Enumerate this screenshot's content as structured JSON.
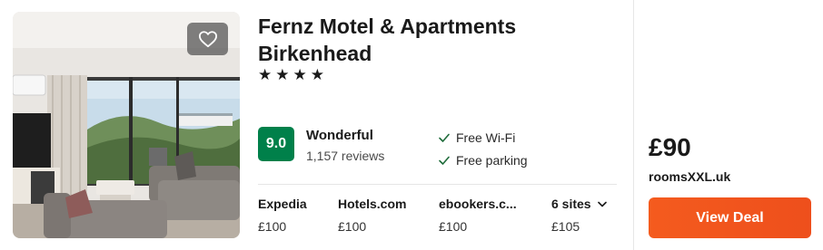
{
  "hotel": {
    "name": "Fernz Motel & Apartments Birkenhead",
    "stars": [
      "★",
      "★",
      "★",
      "★"
    ],
    "photo_alt": "hotel-room-photo"
  },
  "rating": {
    "score": "9.0",
    "label": "Wonderful",
    "reviews": "1,157 reviews",
    "color": "#00804a"
  },
  "amenities": [
    "Free Wi-Fi",
    "Free parking"
  ],
  "sites": [
    {
      "name": "Expedia",
      "price": "£100"
    },
    {
      "name": "Hotels.com",
      "price": "£100"
    },
    {
      "name": "ebookers.c...",
      "price": "£100"
    },
    {
      "name": "6 sites",
      "price": "£105"
    }
  ],
  "deal": {
    "price": "£90",
    "provider": "roomsXXL.uk",
    "button_label": "View Deal",
    "button_color": "#f15a1f"
  },
  "icons": {
    "favorite": "heart-outline-icon",
    "check": "check-icon",
    "expand": "chevron-down-icon"
  }
}
